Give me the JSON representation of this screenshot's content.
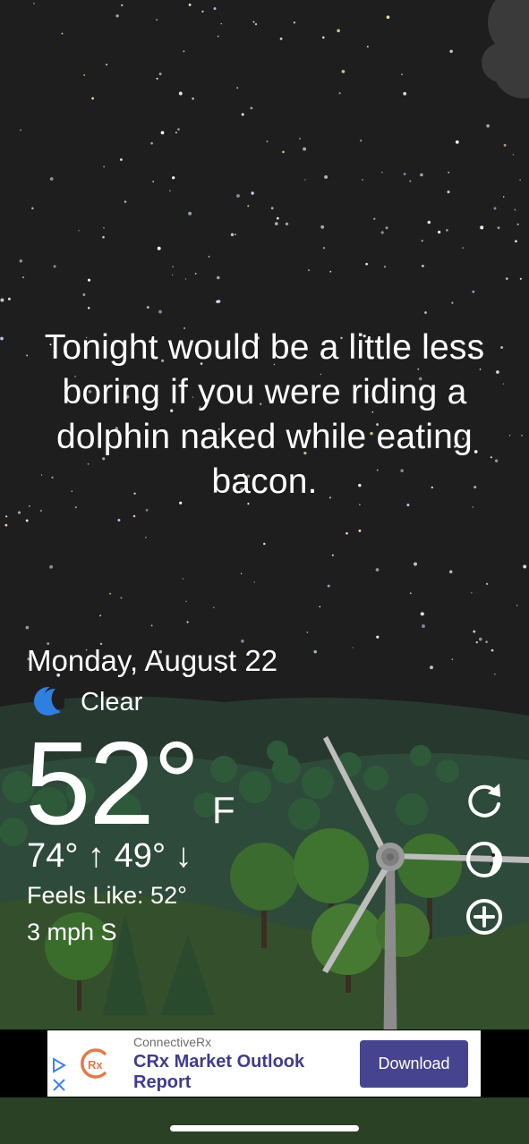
{
  "quote": "Tonight would be a little less boring if you were riding a dolphin naked while eating bacon.",
  "date": "Monday, August 22",
  "condition": {
    "icon": "crescent-moon-icon",
    "text": "Clear"
  },
  "temperature": {
    "value": "52°",
    "unit": "F"
  },
  "high_low": "74° ↑ 49° ↓",
  "feels_like": "Feels Like: 52°",
  "wind": "3 mph S",
  "side_buttons": [
    "refresh-icon",
    "moon-phase-icon",
    "add-location-icon"
  ],
  "ad": {
    "brand": "ConnectiveRx",
    "title": "CRx Market Outlook Report",
    "button": "Download",
    "logo_text": "Rx"
  },
  "colors": {
    "sky": "#1e1e1f",
    "hills": "#2d4a3b",
    "grass": "#344f2c",
    "moon_icon": "#2f7fe0",
    "ad_accent": "#46448f"
  }
}
